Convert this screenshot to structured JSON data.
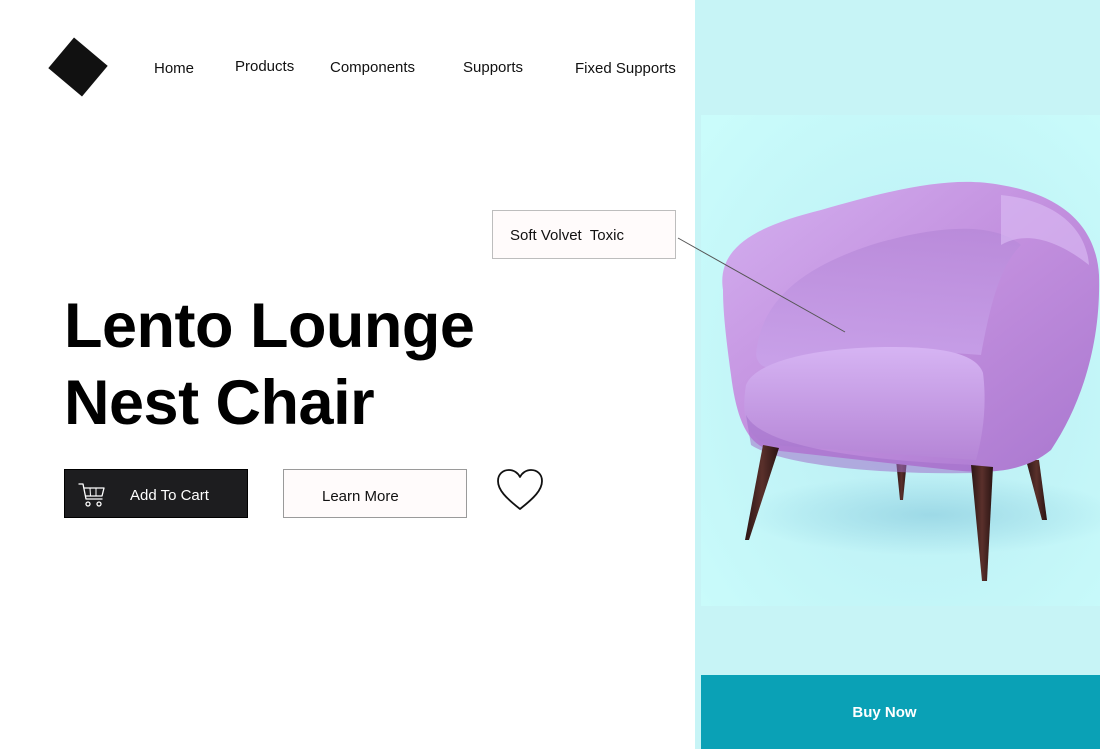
{
  "nav": {
    "logo": "diamond-logo",
    "items": [
      {
        "label": "Home"
      },
      {
        "label": "Products"
      },
      {
        "label": "Components"
      },
      {
        "label": "Supports"
      },
      {
        "label": "Fixed Supports"
      }
    ]
  },
  "hero": {
    "title_line1": "Lento Lounge",
    "title_line2": "Nest Chair",
    "add_to_cart_label": "Add To Cart",
    "cart_icon": "cart-icon",
    "learn_more_label": "Learn More",
    "favorite_icon": "heart-icon"
  },
  "callout": {
    "label": "Soft Volvet  Toxic"
  },
  "product": {
    "buy_now_label": "Buy Now"
  },
  "colors": {
    "panel_background": "#c7f4f6",
    "image_background": "#c8fbfb",
    "buy_now_button": "#0aa1b6",
    "chair_fabric": "#c79ae2",
    "chair_legs": "#3a1f1d",
    "cart_button": "#1d1d1f"
  }
}
